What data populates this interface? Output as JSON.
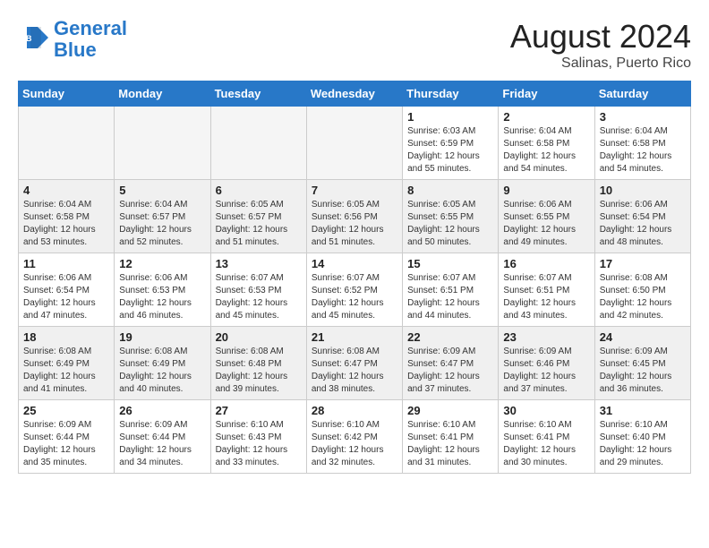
{
  "header": {
    "logo_line1": "General",
    "logo_line2": "Blue",
    "month_year": "August 2024",
    "location": "Salinas, Puerto Rico"
  },
  "days_of_week": [
    "Sunday",
    "Monday",
    "Tuesday",
    "Wednesday",
    "Thursday",
    "Friday",
    "Saturday"
  ],
  "weeks": [
    [
      {
        "day": "",
        "info": ""
      },
      {
        "day": "",
        "info": ""
      },
      {
        "day": "",
        "info": ""
      },
      {
        "day": "",
        "info": ""
      },
      {
        "day": "1",
        "info": "Sunrise: 6:03 AM\nSunset: 6:59 PM\nDaylight: 12 hours\nand 55 minutes."
      },
      {
        "day": "2",
        "info": "Sunrise: 6:04 AM\nSunset: 6:58 PM\nDaylight: 12 hours\nand 54 minutes."
      },
      {
        "day": "3",
        "info": "Sunrise: 6:04 AM\nSunset: 6:58 PM\nDaylight: 12 hours\nand 54 minutes."
      }
    ],
    [
      {
        "day": "4",
        "info": "Sunrise: 6:04 AM\nSunset: 6:58 PM\nDaylight: 12 hours\nand 53 minutes."
      },
      {
        "day": "5",
        "info": "Sunrise: 6:04 AM\nSunset: 6:57 PM\nDaylight: 12 hours\nand 52 minutes."
      },
      {
        "day": "6",
        "info": "Sunrise: 6:05 AM\nSunset: 6:57 PM\nDaylight: 12 hours\nand 51 minutes."
      },
      {
        "day": "7",
        "info": "Sunrise: 6:05 AM\nSunset: 6:56 PM\nDaylight: 12 hours\nand 51 minutes."
      },
      {
        "day": "8",
        "info": "Sunrise: 6:05 AM\nSunset: 6:55 PM\nDaylight: 12 hours\nand 50 minutes."
      },
      {
        "day": "9",
        "info": "Sunrise: 6:06 AM\nSunset: 6:55 PM\nDaylight: 12 hours\nand 49 minutes."
      },
      {
        "day": "10",
        "info": "Sunrise: 6:06 AM\nSunset: 6:54 PM\nDaylight: 12 hours\nand 48 minutes."
      }
    ],
    [
      {
        "day": "11",
        "info": "Sunrise: 6:06 AM\nSunset: 6:54 PM\nDaylight: 12 hours\nand 47 minutes."
      },
      {
        "day": "12",
        "info": "Sunrise: 6:06 AM\nSunset: 6:53 PM\nDaylight: 12 hours\nand 46 minutes."
      },
      {
        "day": "13",
        "info": "Sunrise: 6:07 AM\nSunset: 6:53 PM\nDaylight: 12 hours\nand 45 minutes."
      },
      {
        "day": "14",
        "info": "Sunrise: 6:07 AM\nSunset: 6:52 PM\nDaylight: 12 hours\nand 45 minutes."
      },
      {
        "day": "15",
        "info": "Sunrise: 6:07 AM\nSunset: 6:51 PM\nDaylight: 12 hours\nand 44 minutes."
      },
      {
        "day": "16",
        "info": "Sunrise: 6:07 AM\nSunset: 6:51 PM\nDaylight: 12 hours\nand 43 minutes."
      },
      {
        "day": "17",
        "info": "Sunrise: 6:08 AM\nSunset: 6:50 PM\nDaylight: 12 hours\nand 42 minutes."
      }
    ],
    [
      {
        "day": "18",
        "info": "Sunrise: 6:08 AM\nSunset: 6:49 PM\nDaylight: 12 hours\nand 41 minutes."
      },
      {
        "day": "19",
        "info": "Sunrise: 6:08 AM\nSunset: 6:49 PM\nDaylight: 12 hours\nand 40 minutes."
      },
      {
        "day": "20",
        "info": "Sunrise: 6:08 AM\nSunset: 6:48 PM\nDaylight: 12 hours\nand 39 minutes."
      },
      {
        "day": "21",
        "info": "Sunrise: 6:08 AM\nSunset: 6:47 PM\nDaylight: 12 hours\nand 38 minutes."
      },
      {
        "day": "22",
        "info": "Sunrise: 6:09 AM\nSunset: 6:47 PM\nDaylight: 12 hours\nand 37 minutes."
      },
      {
        "day": "23",
        "info": "Sunrise: 6:09 AM\nSunset: 6:46 PM\nDaylight: 12 hours\nand 37 minutes."
      },
      {
        "day": "24",
        "info": "Sunrise: 6:09 AM\nSunset: 6:45 PM\nDaylight: 12 hours\nand 36 minutes."
      }
    ],
    [
      {
        "day": "25",
        "info": "Sunrise: 6:09 AM\nSunset: 6:44 PM\nDaylight: 12 hours\nand 35 minutes."
      },
      {
        "day": "26",
        "info": "Sunrise: 6:09 AM\nSunset: 6:44 PM\nDaylight: 12 hours\nand 34 minutes."
      },
      {
        "day": "27",
        "info": "Sunrise: 6:10 AM\nSunset: 6:43 PM\nDaylight: 12 hours\nand 33 minutes."
      },
      {
        "day": "28",
        "info": "Sunrise: 6:10 AM\nSunset: 6:42 PM\nDaylight: 12 hours\nand 32 minutes."
      },
      {
        "day": "29",
        "info": "Sunrise: 6:10 AM\nSunset: 6:41 PM\nDaylight: 12 hours\nand 31 minutes."
      },
      {
        "day": "30",
        "info": "Sunrise: 6:10 AM\nSunset: 6:41 PM\nDaylight: 12 hours\nand 30 minutes."
      },
      {
        "day": "31",
        "info": "Sunrise: 6:10 AM\nSunset: 6:40 PM\nDaylight: 12 hours\nand 29 minutes."
      }
    ]
  ]
}
